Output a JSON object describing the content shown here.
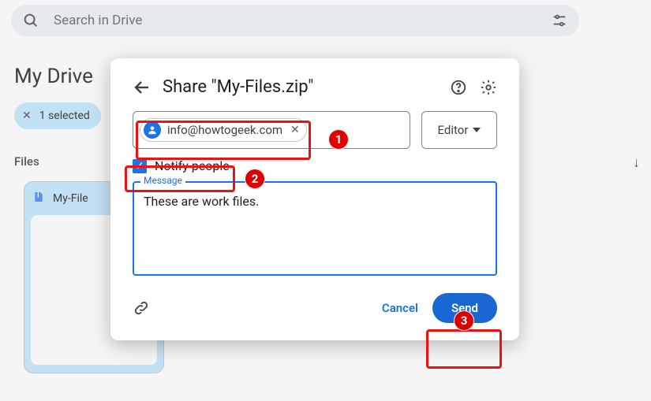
{
  "search": {
    "placeholder": "Search in Drive"
  },
  "page": {
    "title": "My Drive",
    "selection_chip": "1 selected",
    "files_label": "Files"
  },
  "file": {
    "name_truncated": "My-File"
  },
  "modal": {
    "title": "Share \"My-Files.zip\"",
    "email_chip": "info@howtogeek.com",
    "role": "Editor",
    "notify_label": "Notify people",
    "notify_checked": true,
    "message_label": "Message",
    "message_text": "These are work files.",
    "cancel": "Cancel",
    "send": "Send"
  },
  "annotations": {
    "b1": "1",
    "b2": "2",
    "b3": "3"
  }
}
